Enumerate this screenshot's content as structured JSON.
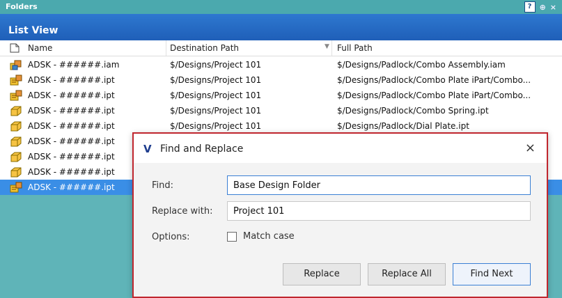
{
  "folders_panel": {
    "title": "Folders",
    "help_label": "?",
    "pin_label": "⊕",
    "close_label": "×"
  },
  "list_view": {
    "title": "List View",
    "columns": {
      "name": "Name",
      "destination": "Destination Path",
      "full": "Full Path"
    },
    "rows": [
      {
        "name": "ADSK - ######.iam",
        "dest": "$/Designs/Project 101",
        "full": "$/Designs/Padlock/Combo Assembly.iam",
        "icon": "assembly-icon"
      },
      {
        "name": "ADSK - ######.ipt",
        "dest": "$/Designs/Project 101",
        "full": "$/Designs/Padlock/Combo Plate iPart/Combo...",
        "icon": "ipart-icon"
      },
      {
        "name": "ADSK - ######.ipt",
        "dest": "$/Designs/Project 101",
        "full": "$/Designs/Padlock/Combo Plate iPart/Combo...",
        "icon": "ipart-icon"
      },
      {
        "name": "ADSK - ######.ipt",
        "dest": "$/Designs/Project 101",
        "full": "$/Designs/Padlock/Combo Spring.ipt",
        "icon": "part-icon"
      },
      {
        "name": "ADSK - ######.ipt",
        "dest": "$/Designs/Project 101",
        "full": "$/Designs/Padlock/Dial Plate.ipt",
        "icon": "part-icon"
      },
      {
        "name": "ADSK - ######.ipt",
        "dest": "",
        "full": "",
        "icon": "part-icon"
      },
      {
        "name": "ADSK - ######.ipt",
        "dest": "",
        "full": "",
        "icon": "part-icon"
      },
      {
        "name": "ADSK - ######.ipt",
        "dest": "",
        "full": "",
        "icon": "part-icon"
      },
      {
        "name": "ADSK - ######.ipt",
        "dest": "",
        "full": "",
        "icon": "ipart-icon",
        "selected": true
      }
    ]
  },
  "dialog": {
    "logo": "V",
    "title": "Find and Replace",
    "close_label": "×",
    "find_label": "Find:",
    "find_value": "Base Design Folder",
    "replace_label": "Replace with:",
    "replace_value": "Project 101",
    "options_label": "Options:",
    "match_case_label": "Match case",
    "buttons": {
      "replace": "Replace",
      "replace_all": "Replace All",
      "find_next": "Find Next"
    }
  },
  "colors": {
    "background": "#5fb4b8",
    "header_blue": "#1f5fb8",
    "selection_blue": "#3a8ee6",
    "dialog_border": "#c0262e"
  }
}
